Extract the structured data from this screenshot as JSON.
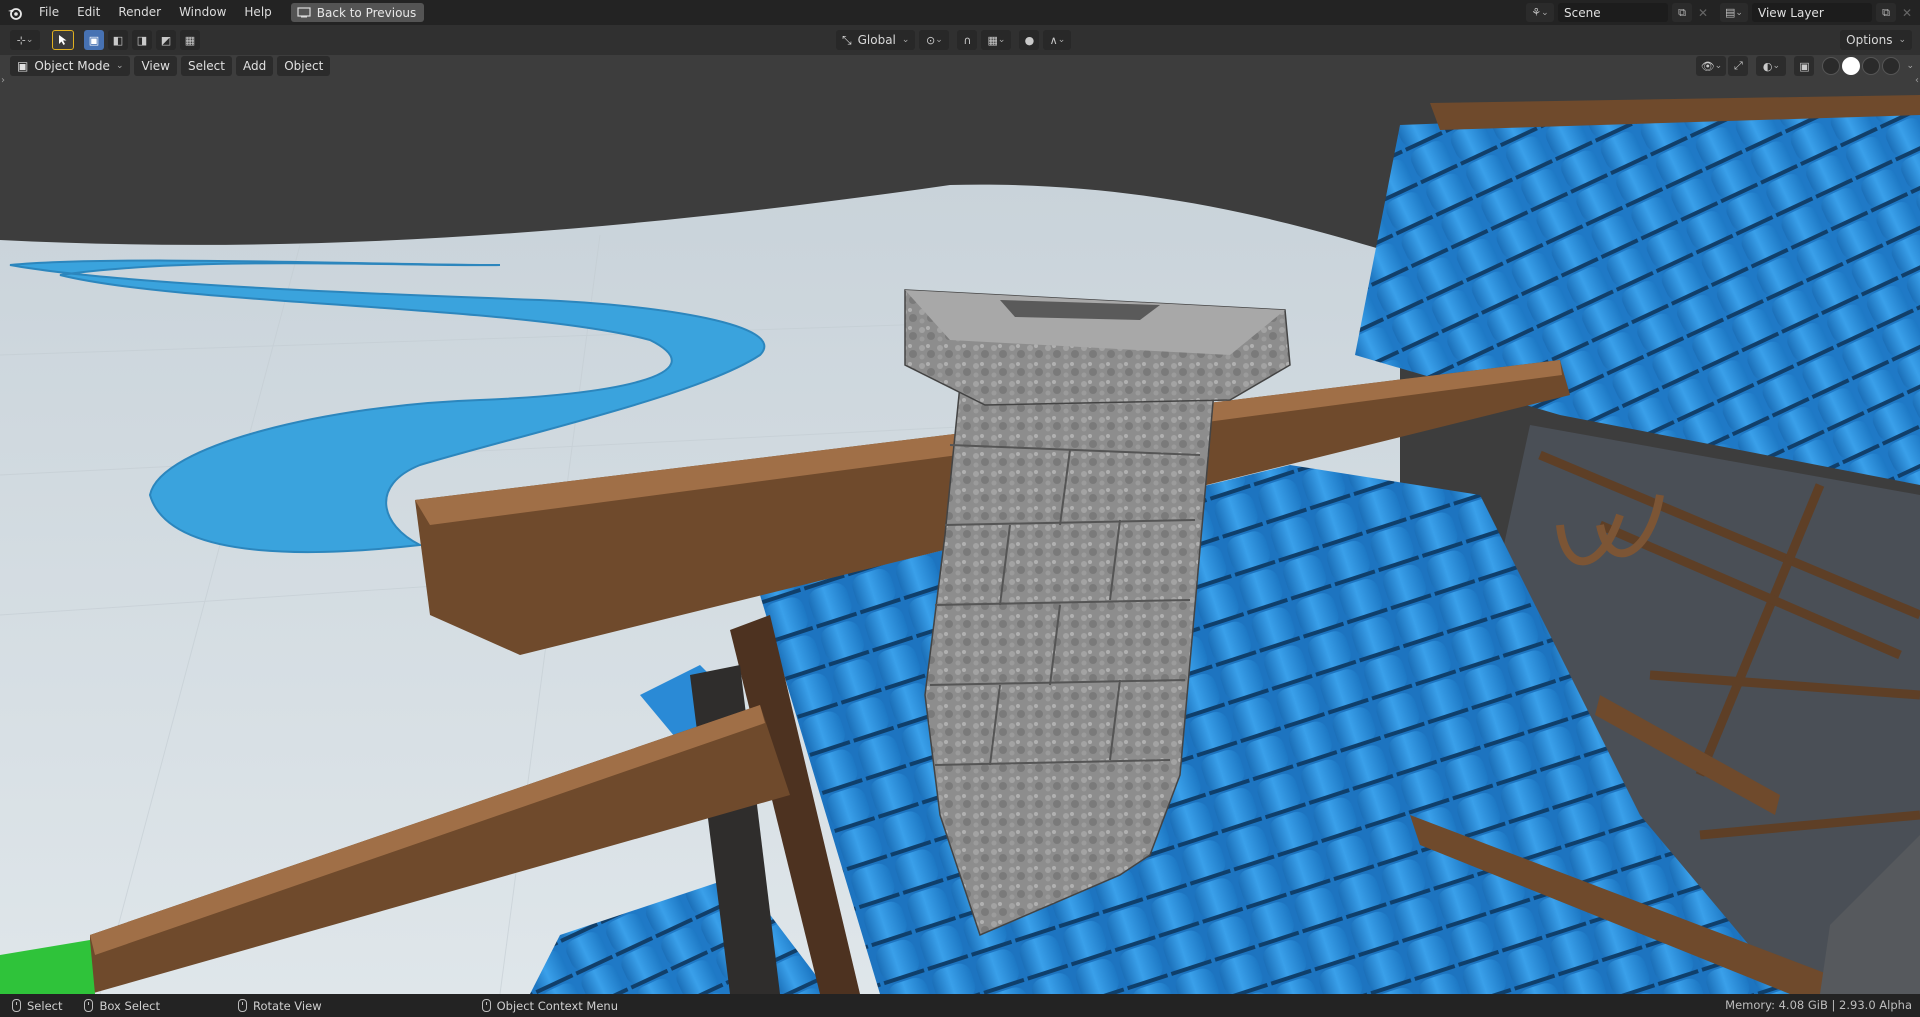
{
  "topbar": {
    "menus": [
      "File",
      "Edit",
      "Render",
      "Window",
      "Help"
    ],
    "back_label": "Back to Previous",
    "scene_value": "Scene",
    "view_layer_value": "View Layer"
  },
  "toolbar": {
    "orientation_value": "Global",
    "options_label": "Options"
  },
  "viewport_header": {
    "mode_value": "Object Mode",
    "menus": [
      "View",
      "Select",
      "Add",
      "Object"
    ]
  },
  "statusbar": {
    "select_label": "Select",
    "box_select_label": "Box Select",
    "rotate_label": "Rotate View",
    "context_label": "Object Context Menu",
    "memory_text": "Memory: 4.08 GiB | 2.93.0 Alpha"
  },
  "colors": {
    "accent": "#4772b3",
    "tile_blue": "#2d8fdc",
    "wood_brown": "#6f4a2c",
    "stone_gray": "#8f8f8f",
    "snow": "#d4dde2",
    "river": "#3aa3dd"
  },
  "icons": [
    "blender-logo-icon",
    "back-icon",
    "scene-icon",
    "view-layer-icon",
    "cursor-icon",
    "transform-icon",
    "snap-icon",
    "proportional-icon",
    "visibility-icon",
    "overlay-icon",
    "xray-icon",
    "mouse-icon"
  ]
}
